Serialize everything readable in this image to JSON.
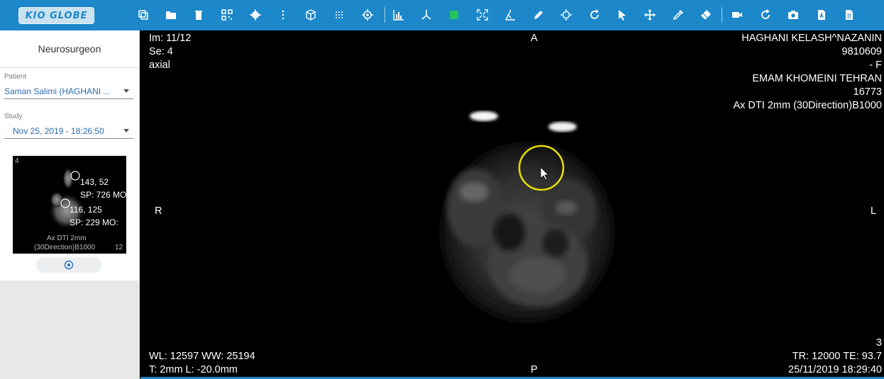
{
  "app": {
    "logo_text": "KIO GLOBE"
  },
  "toolbar": {
    "tools": [
      "copy-icon",
      "folder-icon",
      "trash-icon",
      "qr-grid-icon",
      "gear-icon",
      "more-vertical-icon",
      "cube-icon",
      "grid-dots-icon",
      "target-icon",
      "histogram-icon",
      "axes-icon",
      "color-layer-icon",
      "fullscreen-icon",
      "angle-icon",
      "pencil-icon",
      "pan-crosshair-icon",
      "rotate-icon",
      "pointer-icon",
      "move-icon",
      "eyedropper-icon",
      "eraser-icon",
      "video-icon",
      "refresh-icon",
      "camera-icon",
      "pdf-icon",
      "document-icon"
    ]
  },
  "sidebar": {
    "title": "Neurosurgeon",
    "patient_label": "Patient",
    "patient_value": "Saman Salimi (HAGHANI ...",
    "study_label": "Study",
    "study_value": "Nov 25, 2019 - 18:26:50",
    "thumbnail": {
      "index": "4",
      "point1": "143, 52",
      "sp1": "SP: 726 MO:",
      "point2": "116, 125",
      "sp2": "SP: 229 MO:",
      "series_line1": "Ax DTI 2mm",
      "series_line2": "(30Direction)B1000",
      "count": "12"
    }
  },
  "viewer": {
    "top_left": {
      "image": "Im: 11/12",
      "series": "Se: 4",
      "plane": "axial"
    },
    "top_right": {
      "patient_name": "HAGHANI KELASH^NAZANIN",
      "patient_id": "9810609",
      "sex": "- F",
      "institution": "EMAM KHOMEINI TEHRAN",
      "code": "16773",
      "protocol": "Ax DTI 2mm (30Direction)B1000"
    },
    "orientation": {
      "top": "A",
      "bottom": "P",
      "left": "R",
      "right": "L"
    },
    "bottom_left": {
      "window": "WL: 12597 WW: 25194",
      "thickness": "T: 2mm L: -20.0mm"
    },
    "bottom_right": {
      "number": "3",
      "timing": "TR: 12000 TE: 93.7",
      "datetime": "25/11/2019 18:29:40"
    }
  },
  "colors": {
    "toolbar": "#1c87c9",
    "accent_green": "#22c55e",
    "cursor_ring": "#e8e000"
  }
}
